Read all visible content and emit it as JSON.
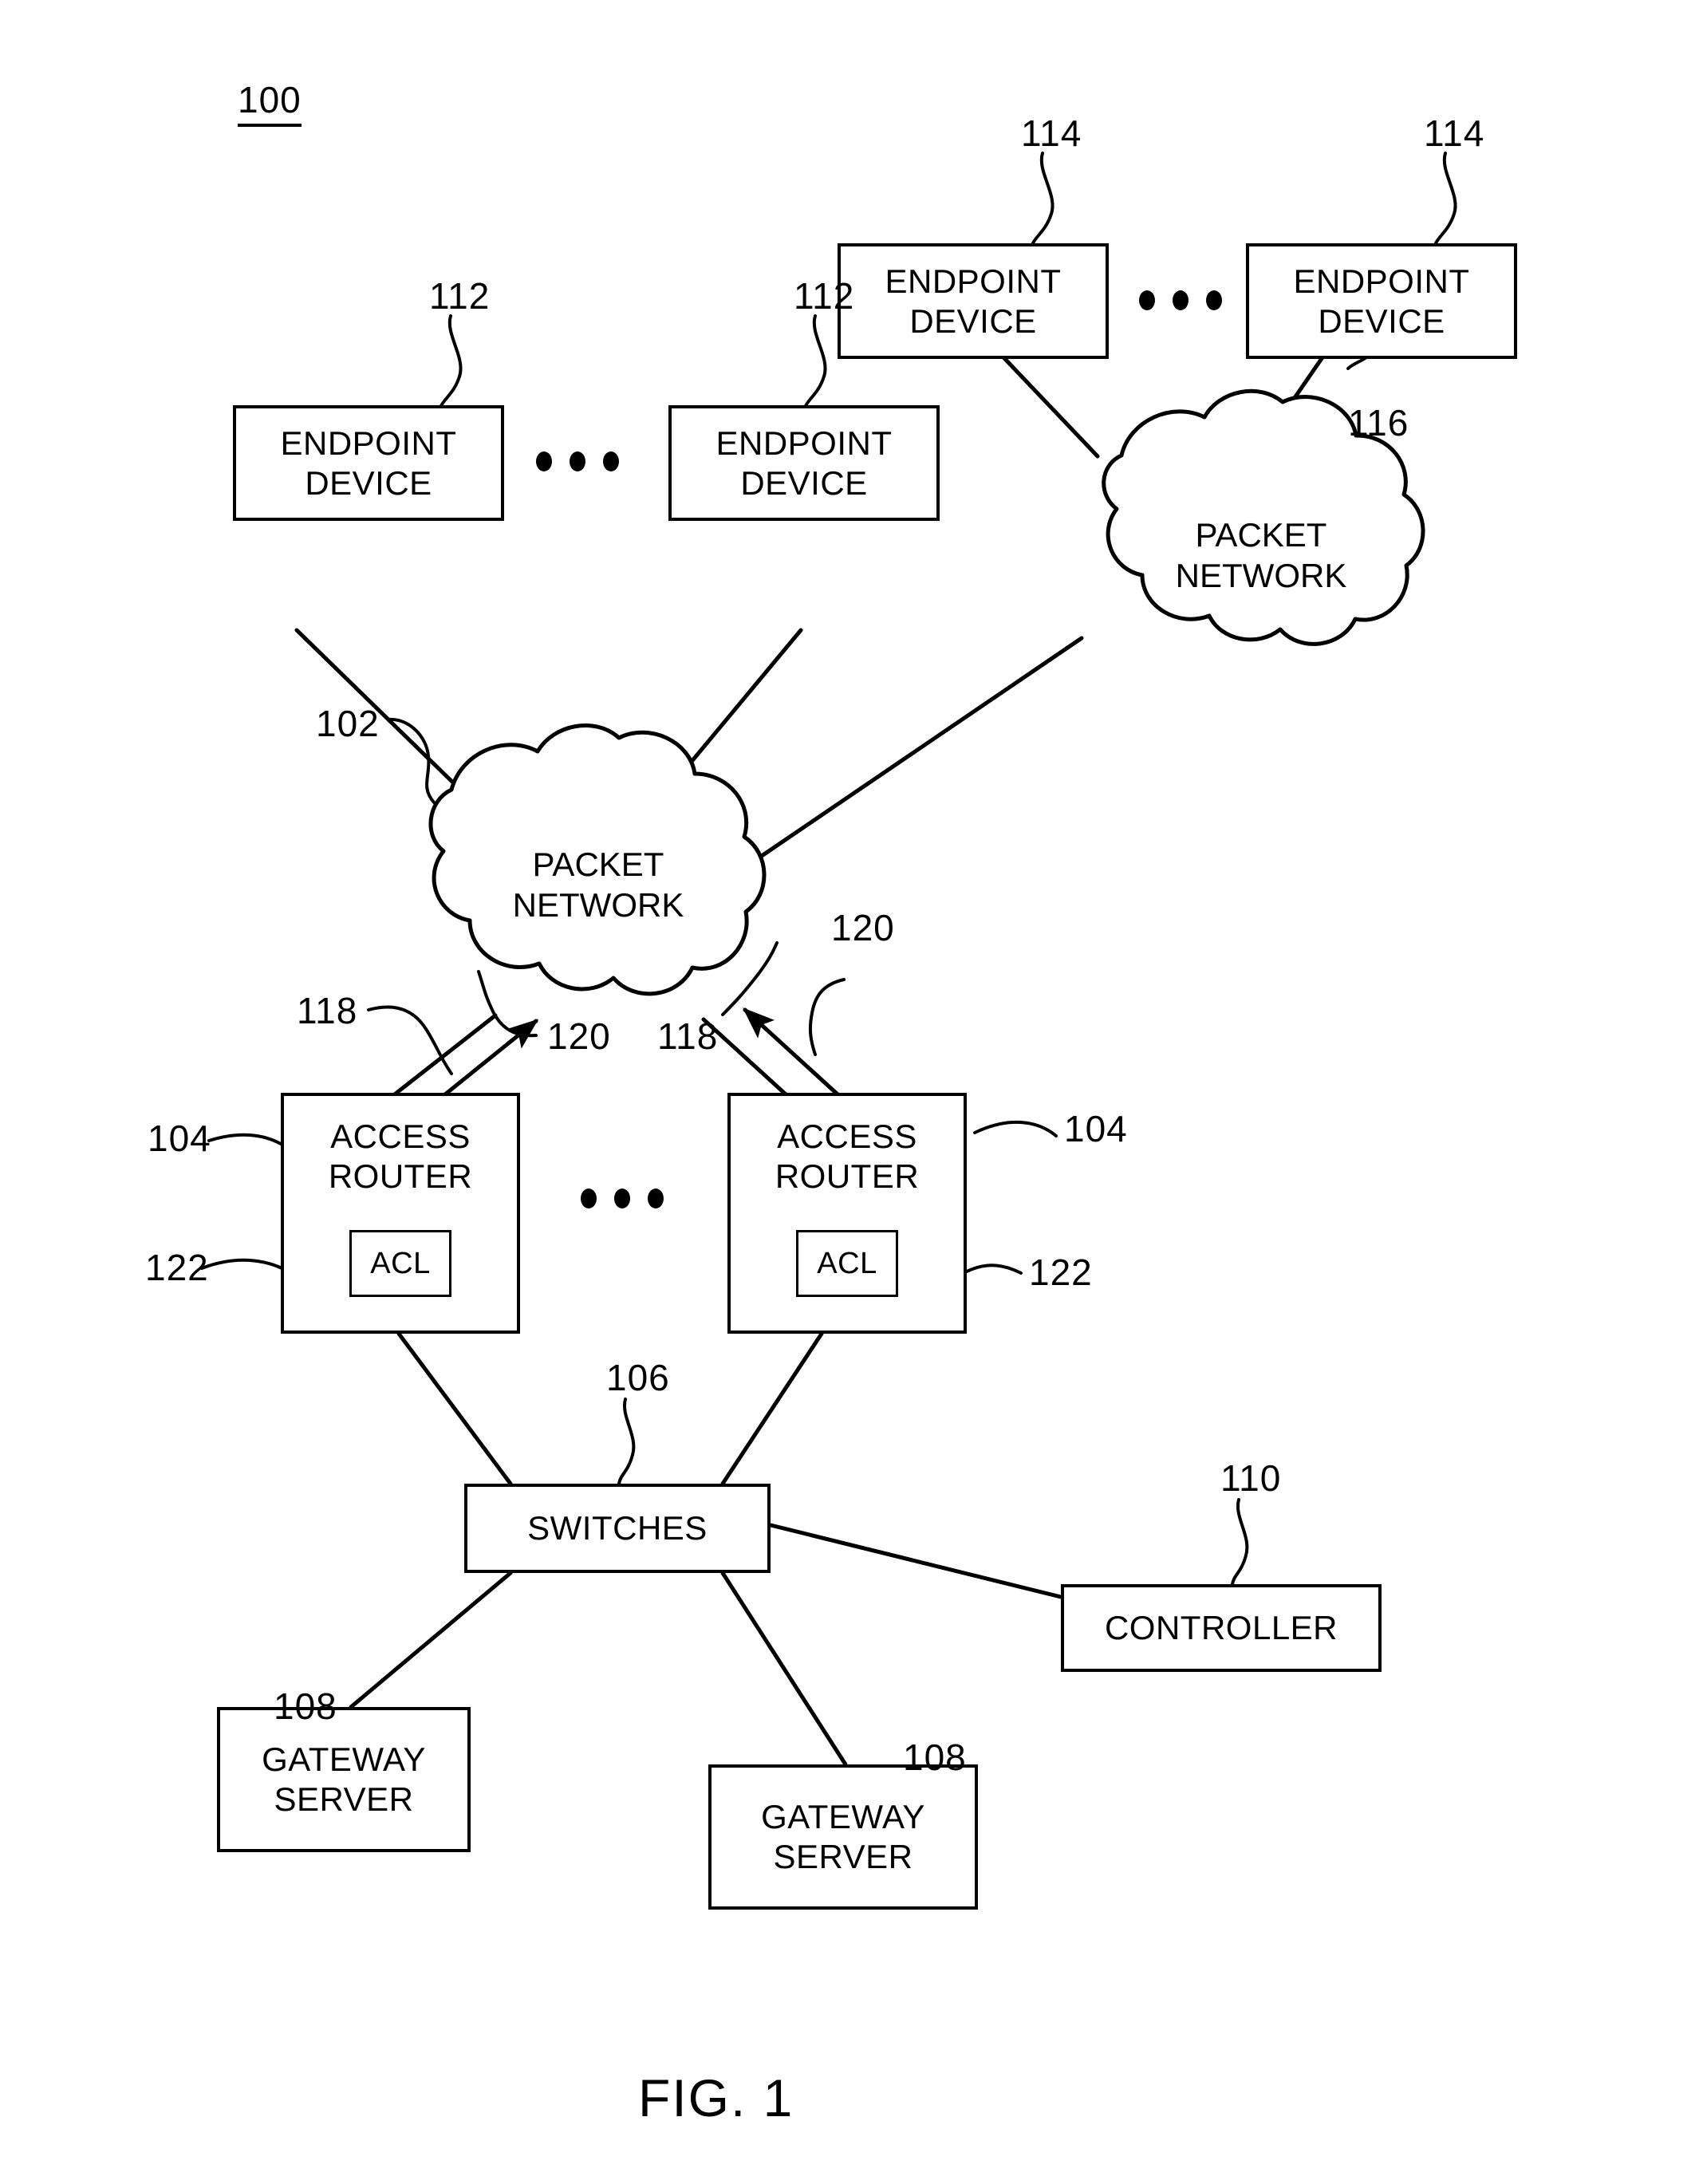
{
  "figure": {
    "caption": "FIG. 1",
    "system_ref": "100"
  },
  "nodes": {
    "endpoint_top_left": {
      "line1": "ENDPOINT",
      "line2": "DEVICE",
      "ref": "114"
    },
    "endpoint_top_right": {
      "line1": "ENDPOINT",
      "line2": "DEVICE",
      "ref": "114"
    },
    "endpoint_mid_left": {
      "line1": "ENDPOINT",
      "line2": "DEVICE",
      "ref": "112"
    },
    "endpoint_mid_right": {
      "line1": "ENDPOINT",
      "line2": "DEVICE",
      "ref": "112"
    },
    "packet_network_upper": {
      "line1": "PACKET",
      "line2": "NETWORK",
      "ref": "116"
    },
    "packet_network_lower": {
      "line1": "PACKET",
      "line2": "NETWORK",
      "ref": "102"
    },
    "access_router_left": {
      "line1": "ACCESS",
      "line2": "ROUTER",
      "ref": "104",
      "acl_label": "ACL",
      "acl_ref": "122"
    },
    "access_router_right": {
      "line1": "ACCESS",
      "line2": "ROUTER",
      "ref": "104",
      "acl_label": "ACL",
      "acl_ref": "122"
    },
    "switches": {
      "line1": "SWITCHES",
      "ref": "106"
    },
    "controller": {
      "line1": "CONTROLLER",
      "ref": "110"
    },
    "gateway_server_left": {
      "line1": "GATEWAY",
      "line2": "SERVER",
      "ref": "108"
    },
    "gateway_server_right": {
      "line1": "GATEWAY",
      "line2": "SERVER",
      "ref": "108"
    }
  },
  "link_refs": {
    "downstream_left": "118",
    "upstream_left": "120",
    "downstream_right": "118",
    "upstream_right": "120"
  },
  "colors": {
    "stroke": "#000000",
    "background": "#ffffff"
  }
}
